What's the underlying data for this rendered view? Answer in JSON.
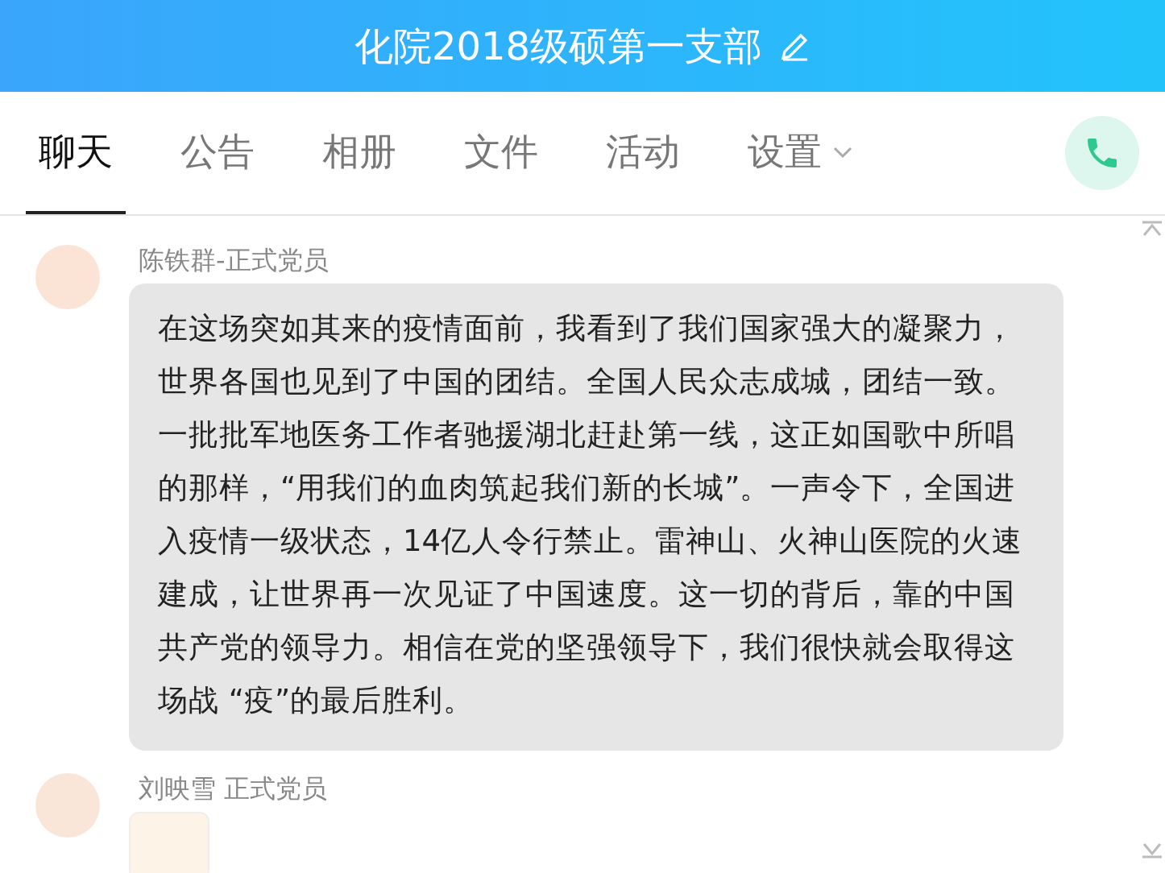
{
  "header": {
    "title": "化院2018级硕第一支部"
  },
  "tabs": [
    {
      "label": "聊天",
      "selected": true
    },
    {
      "label": "公告",
      "selected": false
    },
    {
      "label": "相册",
      "selected": false
    },
    {
      "label": "文件",
      "selected": false
    },
    {
      "label": "活动",
      "selected": false
    },
    {
      "label": "设置",
      "selected": false,
      "kind": "dropdown"
    }
  ],
  "messages": [
    {
      "sender": "陈铁群-正式党员",
      "kind": "text",
      "text": "在这场突如其来的疫情面前，我看到了我们国家强大的凝聚力，世界各国也见到了中国的团结。全国人民众志成城，团结一致。一批批军地医务工作者驰援湖北赶赴第一线，这正如国歌中所唱的那样，“用我们的血肉筑起我们新的长城”。一声令下，全国进入疫情一级状态，14亿人令行禁止。雷神山、火神山医院的火速建成，让世界再一次见证了中国速度。这一切的背后，靠的中国共产党的领导力。相信在党的坚强领导下，我们很快就会取得这场战 “疫”的最后胜利。"
    },
    {
      "sender": "刘映雪 正式党员",
      "kind": "sticker"
    }
  ]
}
